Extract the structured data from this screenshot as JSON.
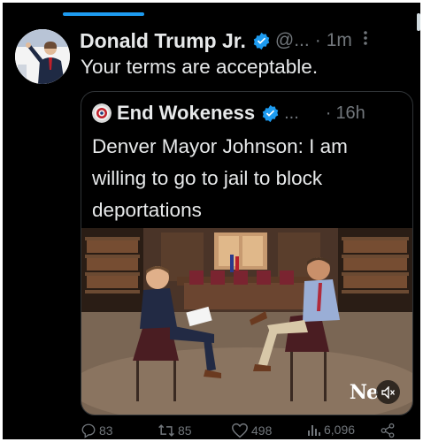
{
  "tweet": {
    "author_name": "Donald Trump Jr.",
    "handle": "@...",
    "separator": "·",
    "time": "1m",
    "more_icon": "more-vertical-icon",
    "text": "Your terms are acceptable."
  },
  "quote": {
    "author_name": "End Wokeness",
    "handle": "...",
    "separator": "·",
    "time": "16h",
    "text": "Denver Mayor Johnson: I am willing to go to jail to block deportations",
    "media": {
      "logo_text": "Ne",
      "mute_icon": "volume-mute-icon"
    }
  },
  "actions": {
    "replies": "83",
    "reposts": "85",
    "likes": "498",
    "views": "6,096",
    "share_icon": "share-icon"
  },
  "colors": {
    "background": "#000000",
    "accent": "#1d9bf0",
    "text_primary": "#e7e9ea",
    "text_secondary": "#71767b",
    "border": "#2f3336"
  }
}
